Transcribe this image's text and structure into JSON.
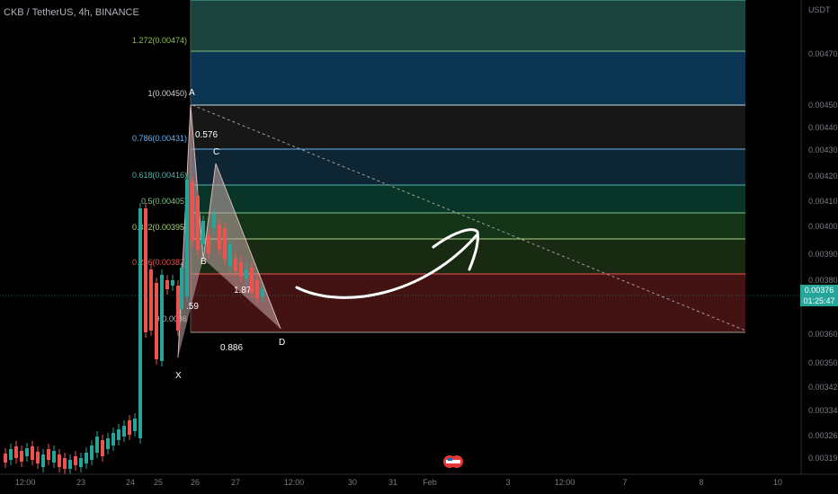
{
  "header": {
    "symbol_line": "CKB / TetherUS, 4h, BINANCE"
  },
  "axis": {
    "unit": "USDT",
    "y_ticks": [
      "0.00470",
      "0.00450",
      "0.00440",
      "0.00430",
      "0.00420",
      "0.00410",
      "0.00400",
      "0.00390",
      "0.00380",
      "0.00360",
      "0.00350",
      "0.00342",
      "0.00334",
      "0.00326",
      "0.00319"
    ],
    "x_ticks": [
      "12:00",
      "23",
      "24",
      "25",
      "26",
      "27",
      "12:00",
      "30",
      "31",
      "Feb",
      "3",
      "12:00",
      "7",
      "8",
      "10"
    ]
  },
  "current_price": {
    "price": "0.00376",
    "countdown": "01:25:47"
  },
  "fib_labels": [
    {
      "text": "1.272(0.00474)",
      "color": "#8bc34a"
    },
    {
      "text": "1(0.00450)",
      "color": "#cfd8dc"
    },
    {
      "text": "0.786(0.00431)",
      "color": "#64b5f6"
    },
    {
      "text": "0.618(0.00416)",
      "color": "#4db6ac"
    },
    {
      "text": "0.5(0.00405)",
      "color": "#81c784"
    },
    {
      "text": "0.382(0.00395)",
      "color": "#aed581"
    },
    {
      "text": "0.236(0.00382)",
      "color": "#ef5350"
    },
    {
      "text": "0(0.0036",
      "color": "#bdbdbd"
    }
  ],
  "pattern_labels": [
    {
      "id": "point-a",
      "text": "A"
    },
    {
      "id": "point-b",
      "text": "B"
    },
    {
      "id": "point-c",
      "text": "C"
    },
    {
      "id": "point-d",
      "text": "D"
    },
    {
      "id": "point-x",
      "text": "X"
    },
    {
      "id": "ratio-ab",
      "text": "0.576"
    },
    {
      "id": "ratio-bc",
      "text": "1.87"
    },
    {
      "id": "ratio-xb",
      "text": ".59"
    },
    {
      "id": "ratio-xd",
      "text": "0.886"
    }
  ],
  "colors": {
    "bull": "#26a69a",
    "bear": "#ef5350",
    "pattern": "#c8a9a9"
  },
  "chart_data": {
    "type": "candlestick",
    "ylim": [
      0.00315,
      0.0049
    ],
    "fib_levels": [
      {
        "ratio": 1.272,
        "price": 0.00474
      },
      {
        "ratio": 1.0,
        "price": 0.0045
      },
      {
        "ratio": 0.786,
        "price": 0.00431
      },
      {
        "ratio": 0.618,
        "price": 0.00416
      },
      {
        "ratio": 0.5,
        "price": 0.00405
      },
      {
        "ratio": 0.382,
        "price": 0.00395
      },
      {
        "ratio": 0.236,
        "price": 0.00382
      },
      {
        "ratio": 0.0,
        "price": 0.00362
      }
    ],
    "pattern_points": {
      "X": 0.00348,
      "A": 0.00451,
      "B": 0.00395,
      "C": 0.00427,
      "D": 0.00362
    }
  }
}
